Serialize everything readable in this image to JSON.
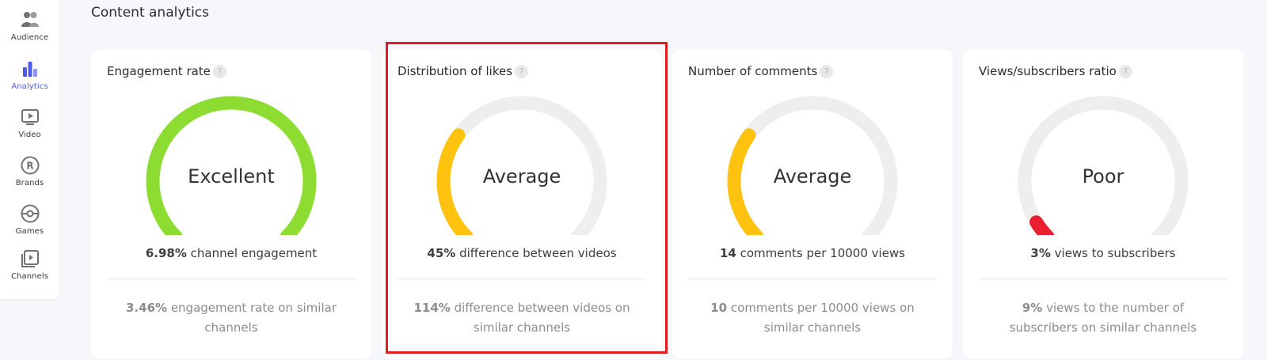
{
  "sidebar": {
    "items": [
      {
        "label": "Audience",
        "icon": "audience-icon",
        "active": false
      },
      {
        "label": "Analytics",
        "icon": "analytics-icon",
        "active": true
      },
      {
        "label": "Video",
        "icon": "video-icon",
        "active": false
      },
      {
        "label": "Brands",
        "icon": "brands-icon",
        "active": false
      },
      {
        "label": "Games",
        "icon": "games-icon",
        "active": false
      },
      {
        "label": "Channels",
        "icon": "channels-icon",
        "active": false
      }
    ]
  },
  "section": {
    "title": "Content analytics"
  },
  "colors": {
    "excellent": "#8ddc31",
    "average": "#ffc20e",
    "poor": "#e8202f",
    "track": "#eeeeee",
    "accent": "#4d5be8",
    "highlight": "#e11b22"
  },
  "cards": [
    {
      "title": "Engagement rate",
      "help": "?",
      "rating": "Excellent",
      "level": 1.0,
      "color": "#8ddc31",
      "main_value": "6.98%",
      "main_text": " channel engagement",
      "sub_value": "3.46%",
      "sub_text": " engagement rate on similar channels"
    },
    {
      "title": "Distribution of likes",
      "help": "?",
      "rating": "Average",
      "level": 0.3,
      "color": "#ffc20e",
      "main_value": "45%",
      "main_text": " difference between videos",
      "sub_value": "114%",
      "sub_text": " difference between videos on similar channels",
      "highlighted": true
    },
    {
      "title": "Number of comments",
      "help": "?",
      "rating": "Average",
      "level": 0.3,
      "color": "#ffc20e",
      "main_value": "14",
      "main_text": " comments per 10000 views",
      "sub_value": "10",
      "sub_text": " comments per 10000 views on similar channels"
    },
    {
      "title": "Views/subscribers ratio",
      "help": "?",
      "rating": "Poor",
      "level": 0.05,
      "color": "#e8202f",
      "main_value": "3%",
      "main_text": " views to subscribers",
      "sub_value": "9%",
      "sub_text": " views to the number of subscribers on similar channels"
    }
  ]
}
